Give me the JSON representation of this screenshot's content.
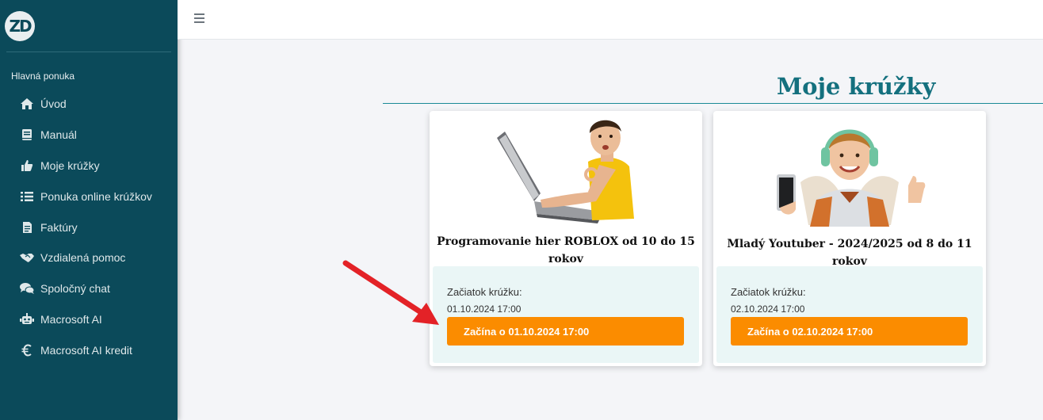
{
  "sidebar": {
    "logo_text": "ZD",
    "heading": "Hlavná ponuka",
    "items": [
      {
        "label": "Úvod",
        "icon": "home-icon"
      },
      {
        "label": "Manuál",
        "icon": "book-icon"
      },
      {
        "label": "Moje krúžky",
        "icon": "thumbs-up-icon"
      },
      {
        "label": "Ponuka online krúžkov",
        "icon": "list-icon"
      },
      {
        "label": "Faktúry",
        "icon": "invoice-icon"
      },
      {
        "label": "Vzdialená pomoc",
        "icon": "handshake-icon"
      },
      {
        "label": "Spoločný chat",
        "icon": "chat-icon"
      },
      {
        "label": "Macrosoft AI",
        "icon": "robot-icon"
      },
      {
        "label": "Macrosoft AI kredit",
        "icon": "euro-icon"
      }
    ]
  },
  "main": {
    "title": "Moje krúžky",
    "cards": [
      {
        "title": "Programovanie hier ROBLOX od 10 do 15 rokov",
        "start_label": "Začiatok krúžku:",
        "start_date": "01.10.2024 17:00",
        "button_label": "Začína o 01.10.2024 17:00"
      },
      {
        "title": "Mladý Youtuber - 2024/2025 od 8 do 11 rokov",
        "start_label": "Začiatok krúžku:",
        "start_date": "02.10.2024 17:00",
        "button_label": "Začína o 02.10.2024 17:00"
      }
    ]
  },
  "colors": {
    "sidebar_bg": "#0b4a5a",
    "title_teal": "#14707e",
    "button_orange": "#fb8c00",
    "arrow_red": "#e32227"
  }
}
